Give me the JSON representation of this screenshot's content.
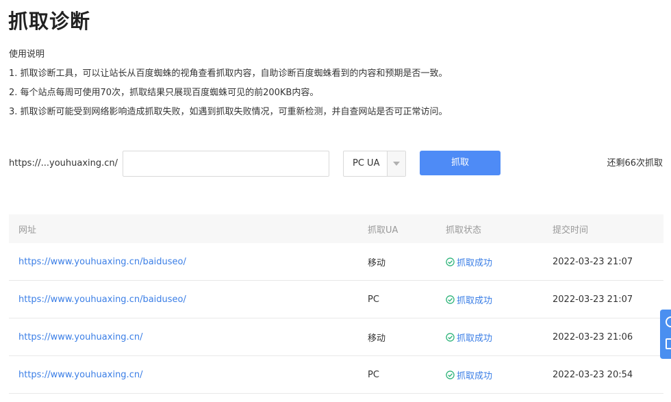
{
  "page": {
    "title": "抓取诊断"
  },
  "instructions": {
    "heading": "使用说明",
    "items": [
      "1. 抓取诊断工具，可以让站长从百度蜘蛛的视角查看抓取内容，自助诊断百度蜘蛛看到的内容和预期是否一致。",
      "2. 每个站点每周可使用70次，抓取结果只展现百度蜘蛛可见的前200KB内容。",
      "3. 抓取诊断可能受到网络影响造成抓取失败，如遇到抓取失败情况，可重新检测，并自查网站是否可正常访问。"
    ]
  },
  "fetch_form": {
    "site_prefix": "https://...youhuaxing.cn/",
    "url_input_value": "",
    "url_input_placeholder": "",
    "ua_selected": "PC UA",
    "fetch_button_label": "抓取",
    "remaining_text": "还剩66次抓取"
  },
  "table": {
    "headers": {
      "url": "网址",
      "ua": "抓取UA",
      "status": "抓取状态",
      "time": "提交时间"
    },
    "rows": [
      {
        "url": "https://www.youhuaxing.cn/baiduseo/",
        "ua": "移动",
        "status": "抓取成功",
        "time": "2022-03-23 21:07"
      },
      {
        "url": "https://www.youhuaxing.cn/baiduseo/",
        "ua": "PC",
        "status": "抓取成功",
        "time": "2022-03-23 21:07"
      },
      {
        "url": "https://www.youhuaxing.cn/",
        "ua": "移动",
        "status": "抓取成功",
        "time": "2022-03-23 21:06"
      },
      {
        "url": "https://www.youhuaxing.cn/",
        "ua": "PC",
        "status": "抓取成功",
        "time": "2022-03-23 20:54"
      }
    ]
  },
  "colors": {
    "primary_button": "#4e8bf6",
    "link": "#3a7ee6",
    "success": "#2fb47a",
    "header_bg": "#f7f7f7"
  },
  "icons": {
    "status_success": "check-circle-icon",
    "select_arrow": "chevron-down-icon"
  }
}
